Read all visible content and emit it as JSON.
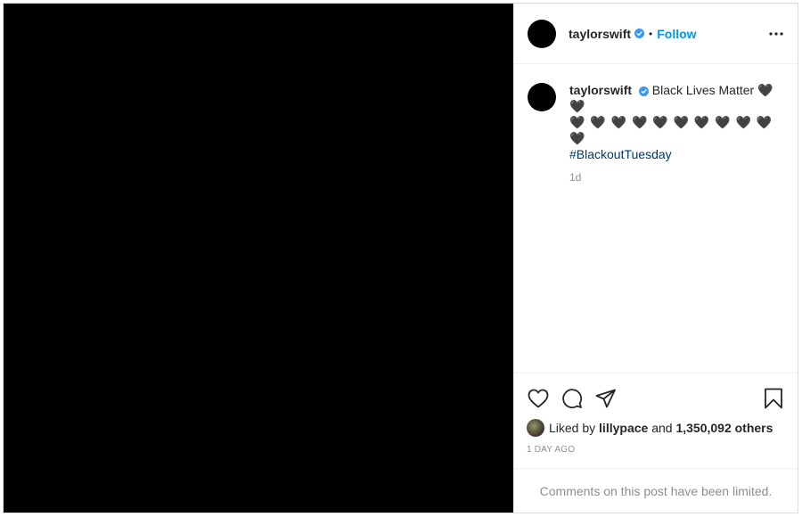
{
  "header": {
    "username": "taylorswift",
    "separator": "•",
    "follow_label": "Follow",
    "more_icon": "more-options-icon"
  },
  "caption": {
    "username": "taylorswift",
    "text": "Black Lives Matter",
    "hearts_line1": "🖤 🖤",
    "hearts_line2": "🖤 🖤 🖤 🖤 🖤 🖤 🖤 🖤 🖤 🖤 🖤",
    "hashtag": "#BlackoutTuesday",
    "age": "1d"
  },
  "actions": {
    "icons": [
      "heart-icon",
      "comment-icon",
      "share-icon",
      "bookmark-icon"
    ]
  },
  "likes": {
    "prefix": "Liked by",
    "user": "lillypace",
    "conjunction": "and",
    "others": "1,350,092 others"
  },
  "timestamp": "1 DAY AGO",
  "comments_notice": "Comments on this post have been limited.",
  "colors": {
    "accent": "#0095f6",
    "hashtag": "#00376b",
    "verified": "#3897f0",
    "muted": "#8e8e8e"
  }
}
